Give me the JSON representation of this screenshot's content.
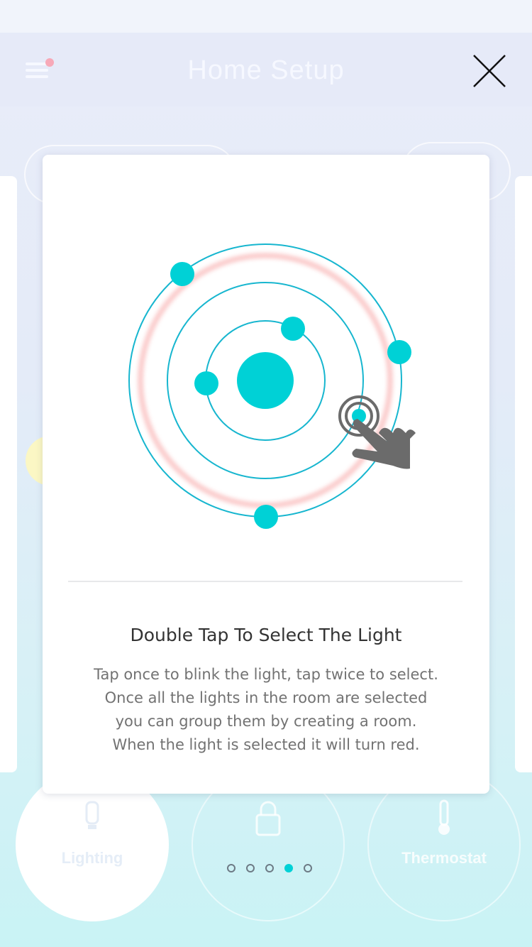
{
  "header": {
    "title": "Home Setup"
  },
  "card": {
    "title": "Double Tap To Select The Light",
    "body": "Tap once to blink the light, tap twice to select.\nOnce all the lights in the room are selected\nyou can group them by creating a room.\nWhen the light is selected it will turn red."
  },
  "categories": [
    {
      "label": "Lighting",
      "icon": "bulb-icon"
    },
    {
      "label": "",
      "icon": "lock-icon"
    },
    {
      "label": "Thermostat",
      "icon": "thermometer-icon"
    }
  ],
  "pager": {
    "count": 5,
    "active_index": 3
  },
  "colors": {
    "accent": "#00d1d6",
    "selected_ring": "#f7a3a3",
    "hand": "#6b6b6b",
    "title_text": "#333333",
    "body_text": "#727272"
  }
}
